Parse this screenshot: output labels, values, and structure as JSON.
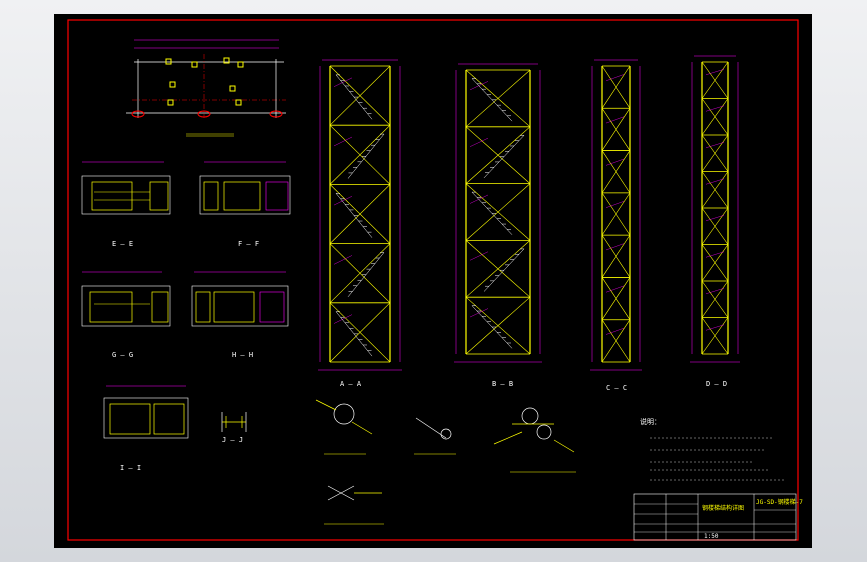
{
  "section_labels": {
    "e": "E — E",
    "f": "F — F",
    "g": "G — G",
    "h": "H — H",
    "i": "I — I",
    "j": "J — J",
    "a": "A — A",
    "b": "B — B",
    "c": "C — C",
    "d": "D — D"
  },
  "notes_title": "说明：",
  "title_block": {
    "drawing_name": "钢楼梯结构详图",
    "drawing_no": "JG-SD-钢楼梯-7",
    "scale": "1:50"
  },
  "colors": {
    "background": "#000000",
    "border": "#ff0000",
    "structure": "#ffff00",
    "dimension": "#ff00ff",
    "text": "#ffffff",
    "accent": "#00ff00"
  }
}
